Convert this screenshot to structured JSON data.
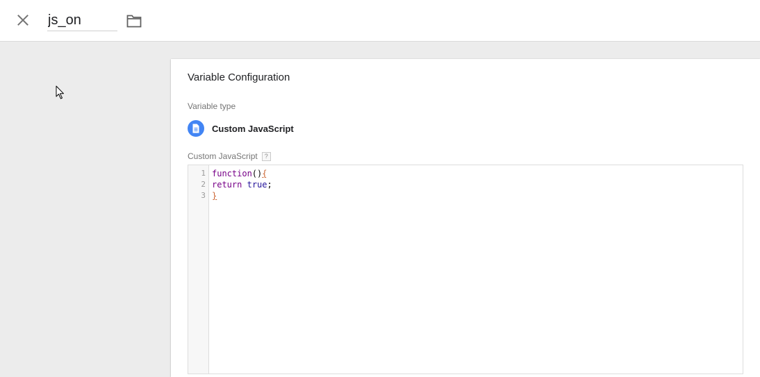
{
  "header": {
    "variable_name": "js_on",
    "close_icon": "close-icon",
    "folder_icon": "folder-icon"
  },
  "panel": {
    "title": "Variable Configuration",
    "type_label": "Variable type",
    "type_name": "Custom JavaScript",
    "type_icon": "document-icon",
    "type_icon_color": "#4285f4",
    "code_label": "Custom JavaScript",
    "help_glyph": "?"
  },
  "editor": {
    "line_numbers": [
      "1",
      "2",
      "3"
    ],
    "lines": [
      {
        "keyword": "function",
        "paren": "()",
        "brace": "{"
      },
      {
        "keyword": "return",
        "space": " ",
        "atom": "true",
        "end": ";"
      },
      {
        "brace": "}"
      }
    ]
  },
  "colors": {
    "keyword": "#770088",
    "atom": "#221199",
    "matched_bracket": "#cc6633",
    "background": "#ececec"
  }
}
